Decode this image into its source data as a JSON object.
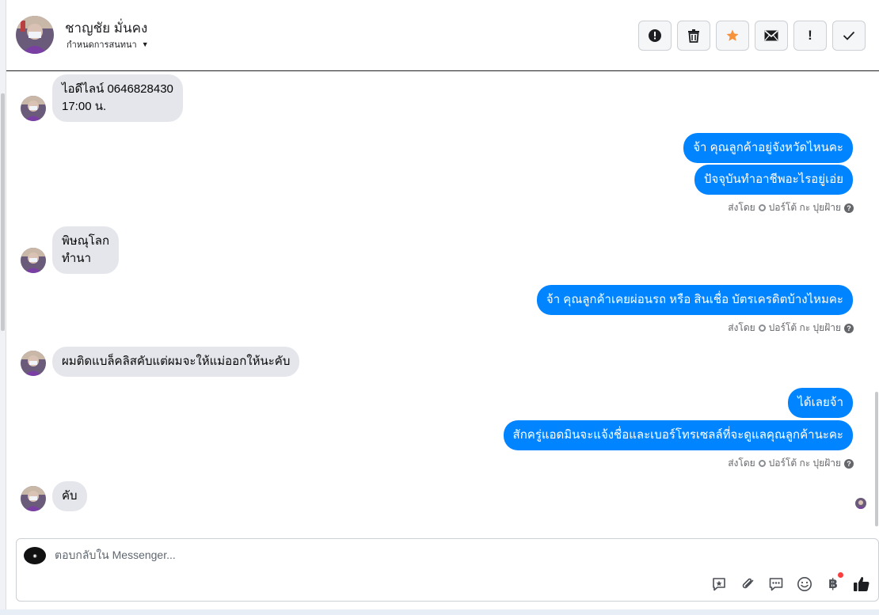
{
  "header": {
    "contact_name": "ชาญชัย มั่นคง",
    "assign_label": "กำหนดการสนทนา",
    "toolbar": [
      {
        "name": "report-spam-button",
        "icon": "exclamation-circle-icon"
      },
      {
        "name": "delete-button",
        "icon": "trash-icon"
      },
      {
        "name": "star-button",
        "icon": "star-icon",
        "color": "#f7923b"
      },
      {
        "name": "mark-unread-button",
        "icon": "envelope-icon"
      },
      {
        "name": "follow-up-button",
        "icon": "exclamation-icon"
      },
      {
        "name": "mark-done-button",
        "icon": "check-icon"
      }
    ]
  },
  "messages": {
    "m1_line1": "ไอดีไลน์ 0646828430",
    "m1_line2": "17:00 น.",
    "m2": "จ้า คุณลูกค้าอยู่จังหวัดไหนคะ",
    "m3": "ปัจจุบันทำอาชีพอะไรอยู่เอ่ย",
    "m4_line1": "พิษณุโลก",
    "m4_line2": "ทำนา",
    "m5": "จ้า คุณลูกค้าเคยผ่อนรถ หรือ สินเชื่อ บัตรเครดิตบ้างไหมคะ",
    "m6": "ผมติดแบล็คลิสคับแต่ผมจะให้แม่ออกให้นะคับ",
    "m7": "ได้เลยจ้า",
    "m8": "สักครู่แอดมินจะแจ้งชื่อและเบอร์โทรเซลล์ที่จะดูแลคุณลูกค้านะคะ",
    "m9": "คับ"
  },
  "sent_by": {
    "prefix": "ส่งโดย",
    "agent": "ปอร์โต้ กะ ปุยฝ้าย"
  },
  "composer": {
    "placeholder": "ตอบกลับใน Messenger...",
    "baht_symbol": "฿",
    "actions": [
      "saved-reply-icon",
      "attachment-icon",
      "chat-icon",
      "emoji-icon",
      "payment-icon",
      "like-icon"
    ]
  },
  "colors": {
    "outgoing_bubble": "#0084ff",
    "incoming_bubble": "#e4e6eb",
    "star": "#f7923b"
  }
}
